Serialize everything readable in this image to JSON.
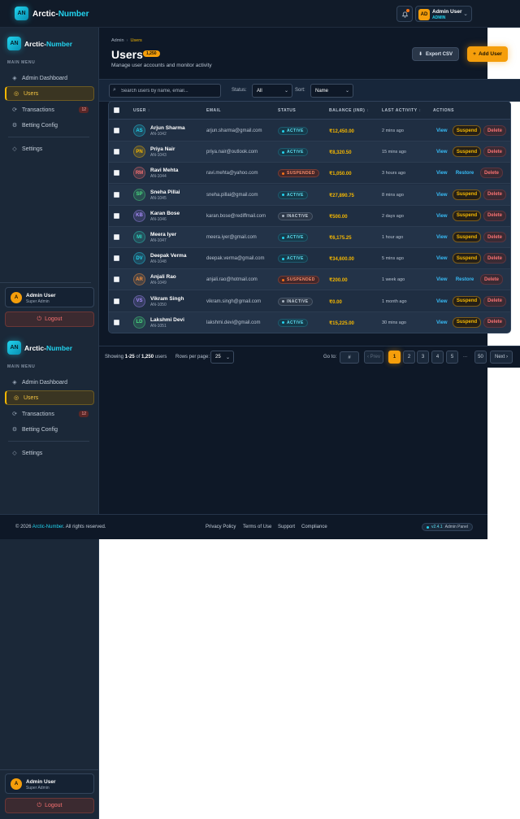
{
  "brand": {
    "logo": "AN",
    "name_a": "Arctic-",
    "name_b": "Number"
  },
  "header": {
    "user_initials": "AD",
    "user_name": "Admin User",
    "user_role": "ADMIN",
    "bell_icon": "bell-icon"
  },
  "sidebar": {
    "section": "MAIN MENU",
    "items": [
      {
        "label": "Admin Dashboard",
        "icon": "◈"
      },
      {
        "label": "Users",
        "icon": "◎"
      },
      {
        "label": "Transactions",
        "icon": "⟳",
        "badge": "12"
      },
      {
        "label": "Betting Config",
        "icon": "⚙"
      },
      {
        "label": "Settings",
        "icon": "◇"
      }
    ],
    "user_initial": "A",
    "user_name": "Admin User",
    "user_role": "Super Admin",
    "logout": "Logout"
  },
  "page": {
    "breadcrumb_root": "Admin",
    "breadcrumb_current": "Users",
    "title": "Users",
    "count": "1,250",
    "subtitle": "Manage user accounts and monitor activity",
    "export_label": "Export CSV",
    "add_label": "Add User"
  },
  "filters": {
    "search_placeholder": "Search users by name, email...",
    "status_label": "Status:",
    "status_value": "All",
    "sort_label": "Sort:",
    "sort_value": "Name"
  },
  "table": {
    "columns": [
      "USER",
      "EMAIL",
      "STATUS",
      "BALANCE (INR)",
      "LAST ACTIVITY",
      "ACTIONS"
    ],
    "rows": [
      {
        "initials": "AS",
        "name": "Arjun Sharma",
        "id": "AN-1042",
        "email": "arjun.sharma@gmail.com",
        "status": "ACTIVE",
        "balance": "₹12,450.00",
        "last": "2 mins ago",
        "view": "View",
        "action": "Suspend",
        "delete": "Delete",
        "color": "#22d3ee"
      },
      {
        "initials": "PN",
        "name": "Priya Nair",
        "id": "AN-1043",
        "email": "priya.nair@outlook.com",
        "status": "ACTIVE",
        "balance": "₹8,320.50",
        "last": "15 mins ago",
        "view": "View",
        "action": "Suspend",
        "delete": "Delete",
        "color": "#f5b700"
      },
      {
        "initials": "RM",
        "name": "Ravi Mehta",
        "id": "AN-1044",
        "email": "ravi.mehta@yahoo.com",
        "status": "SUSPENDED",
        "balance": "₹1,050.00",
        "last": "3 hours ago",
        "view": "View",
        "action": "Restore",
        "delete": "Delete",
        "color": "#f87171"
      },
      {
        "initials": "SP",
        "name": "Sneha Pillai",
        "id": "AN-1045",
        "email": "sneha.pillai@gmail.com",
        "status": "ACTIVE",
        "balance": "₹27,890.75",
        "last": "8 mins ago",
        "view": "View",
        "action": "Suspend",
        "delete": "Delete",
        "color": "#4ade80"
      },
      {
        "initials": "KB",
        "name": "Karan Bose",
        "id": "AN-1046",
        "email": "karan.bose@rediffmail.com",
        "status": "INACTIVE",
        "balance": "₹500.00",
        "last": "2 days ago",
        "view": "View",
        "action": "Suspend",
        "delete": "Delete",
        "color": "#a78bfa"
      },
      {
        "initials": "MI",
        "name": "Meera Iyer",
        "id": "AN-1047",
        "email": "meera.iyer@gmail.com",
        "status": "ACTIVE",
        "balance": "₹6,175.25",
        "last": "1 hour ago",
        "view": "View",
        "action": "Suspend",
        "delete": "Delete",
        "color": "#2dd4bf"
      },
      {
        "initials": "DV",
        "name": "Deepak Verma",
        "id": "AN-1048",
        "email": "deepak.verma@gmail.com",
        "status": "ACTIVE",
        "balance": "₹34,600.00",
        "last": "5 mins ago",
        "view": "View",
        "action": "Suspend",
        "delete": "Delete",
        "color": "#22d3ee"
      },
      {
        "initials": "AR",
        "name": "Anjali Rao",
        "id": "AN-1049",
        "email": "anjali.rao@hotmail.com",
        "status": "SUSPENDED",
        "balance": "₹200.00",
        "last": "1 week ago",
        "view": "View",
        "action": "Restore",
        "delete": "Delete",
        "color": "#fb923c"
      },
      {
        "initials": "VS",
        "name": "Vikram Singh",
        "id": "AN-1050",
        "email": "vikram.singh@gmail.com",
        "status": "INACTIVE",
        "balance": "₹0.00",
        "last": "1 month ago",
        "view": "View",
        "action": "Suspend",
        "delete": "Delete",
        "color": "#a78bfa"
      },
      {
        "initials": "LD",
        "name": "Lakshmi Devi",
        "id": "AN-1051",
        "email": "lakshmi.devi@gmail.com",
        "status": "ACTIVE",
        "balance": "₹15,225.00",
        "last": "30 mins ago",
        "view": "View",
        "action": "Suspend",
        "delete": "Delete",
        "color": "#4ade80"
      }
    ]
  },
  "pagination": {
    "showing_prefix": "Showing ",
    "range": "1-25",
    "of": " of ",
    "total": "1,250",
    "suffix": " users",
    "rpp_label": "Rows per page:",
    "rpp_value": "25",
    "goto_label": "Go to:",
    "goto_value": "#",
    "prev": "‹ Prev",
    "pages": [
      "1",
      "2",
      "3",
      "4",
      "5"
    ],
    "ellipsis": "...",
    "last_page": "50",
    "next": "Next ›"
  },
  "footer": {
    "copy_prefix": "© 2026 ",
    "copy_brand": "Arctic-Number",
    "copy_suffix": ". All rights reserved.",
    "links": [
      "Privacy Policy",
      "Terms of Use",
      "Support",
      "Compliance"
    ],
    "version": "v2.4.1",
    "version_label": "Admin Panel"
  }
}
